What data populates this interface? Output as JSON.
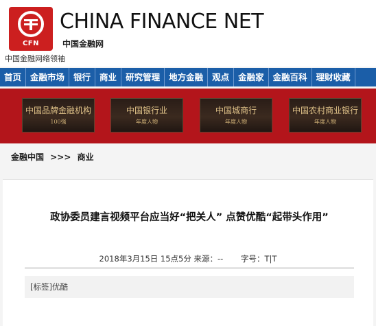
{
  "header": {
    "logo_text": "CFN",
    "brand_en": "CHINA FINANCE NET",
    "brand_cn": "中国金融网",
    "slogan": "中国金融网络领袖",
    "colors": {
      "logo_red": "#cc1f1f",
      "nav_blue": "#1b5ea8",
      "banner_red": "#b3151b"
    }
  },
  "nav": {
    "items": [
      "首页",
      "金融市场",
      "银行",
      "商业",
      "研究管理",
      "地方金融",
      "观点",
      "金融家",
      "金融百科",
      "理财收藏"
    ]
  },
  "banner": {
    "tiles": [
      {
        "title": "中国品牌金融机构",
        "subtitle": "100强"
      },
      {
        "title": "中国银行业",
        "subtitle": "年度人物"
      },
      {
        "title": "中国城商行",
        "subtitle": "年度人物"
      },
      {
        "title": "中国农村商业银行",
        "subtitle": "年度人物"
      }
    ]
  },
  "breadcrumb": {
    "home": "金融中国",
    "separator": ">>>",
    "current": "商业"
  },
  "article": {
    "title": "政协委员建言视频平台应当好“把关人” 点赞优酷“起带头作用”",
    "date": "2018年3月15日 15点5分",
    "source_label": "来源：--",
    "font_size_label": "字号：T|T",
    "tags": "[标签]优酷"
  }
}
